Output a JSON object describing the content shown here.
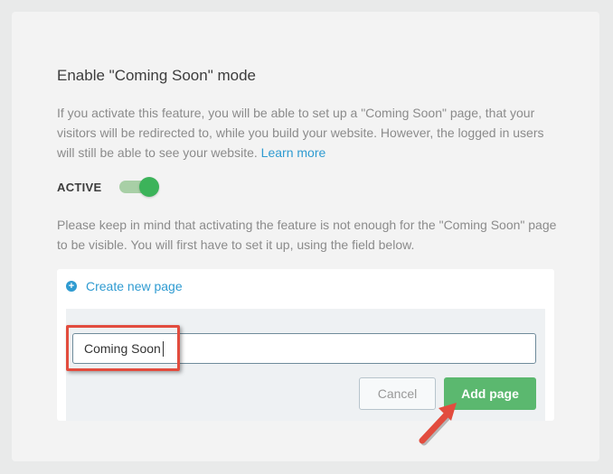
{
  "section": {
    "title": "Enable \"Coming Soon\" mode",
    "description": "If you activate this feature, you will be able to set up a \"Coming Soon\" page, that your visitors will be redirected to, while you build your website. However, the logged in users will still be able to see your website.",
    "learn_more": "Learn more"
  },
  "status": {
    "label": "ACTIVE",
    "enabled": true
  },
  "note": "Please keep in mind that activating the feature is not enough for the \"Coming Soon\" page to be visible. You will first have to set it up, using the field below.",
  "create_page": {
    "link_label": "Create new page",
    "input_value": "Coming Soon",
    "cancel_label": "Cancel",
    "add_label": "Add page"
  },
  "icons": {
    "create_link": "plus-circle-icon"
  },
  "colors": {
    "link": "#2f9bd1",
    "toggle_on": "#3cb35a",
    "add_button": "#5bb86f",
    "highlight": "#e24c3e"
  }
}
